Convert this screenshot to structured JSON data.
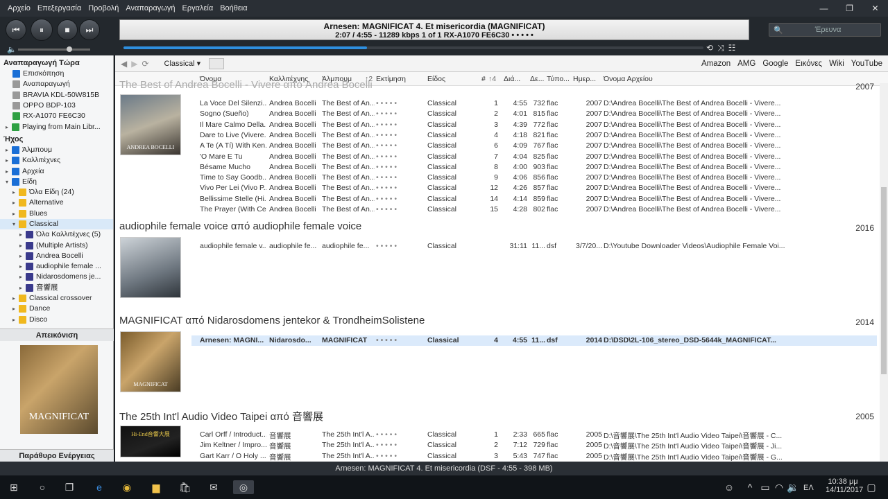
{
  "menu": [
    "Αρχείο",
    "Επεξεργασία",
    "Προβολή",
    "Αναπαραγωγή",
    "Εργαλεία",
    "Βοήθεια"
  ],
  "window_controls": {
    "min": "—",
    "max": "❐",
    "close": "✕"
  },
  "now_playing": {
    "line1": "Arnesen: MAGNIFICAT 4. Et misericordia (MAGNIFICAT)",
    "line2": "2:07 / 4:55 - 11289 kbps   1 of 1  RX-A1070 FE6C30  • • • • •",
    "progress": 0.42
  },
  "search_placeholder": "Έρευνα",
  "volume": 0.7,
  "left": {
    "playing_now_title": "Αναπαραγωγή Τώρα",
    "playing_items": [
      "Επισκόπηση",
      "Αναπαραγωγή",
      "BRAVIA KDL-50W815B",
      "OPPO BDP-103",
      "RX-A1070 FE6C30",
      "Playing from Main Libr..."
    ],
    "audio_title": "Ήχος",
    "audio_items": [
      "Άλμπουμ",
      "Καλλιτέχνες",
      "Αρχεία",
      "Είδη"
    ],
    "genres": [
      "Όλα Είδη (24)",
      "Alternative",
      "Blues",
      "Classical"
    ],
    "classical_children": [
      "Όλα Καλλιτέχνες (5)",
      "(Multiple Artists)",
      "Andrea Bocelli",
      "audiophile female ...",
      "Nidarosdomens je...",
      "音響展"
    ],
    "more_genres": [
      "Classical crossover",
      "Dance",
      "Disco"
    ],
    "preview_title": "Απεικόνιση",
    "action_title": "Παράθυρο Ενέργειας"
  },
  "toolbar": {
    "view_label": "Classical ▾",
    "links": [
      "Amazon",
      "AMG",
      "Google",
      "Εικόνες",
      "Wiki",
      "YouTube"
    ]
  },
  "columns": [
    "Όνομα",
    "Καλλιτέχνης",
    "Άλμπουμ",
    "Εκτίμηση",
    "Είδος",
    "#",
    "Διά...",
    "Δε...",
    "Τύπο...",
    "Ημερ...",
    "Όνομα Αρχείου"
  ],
  "column_sort": [
    "",
    "",
    "↑2",
    "",
    "",
    "↑4",
    "",
    "",
    "",
    "",
    ""
  ],
  "groups": [
    {
      "title": "The Best of Andrea Bocelli - Vivere από Andrea Bocelli",
      "year": "2007",
      "rows": [
        [
          "La Voce Del Silenzi...",
          "Andrea Bocelli",
          "The Best of An...",
          "• • • • •",
          "Classical",
          "1",
          "4:55",
          "732",
          "flac",
          "2007",
          "D:\\Andrea Bocelli\\The Best of Andrea Bocelli - Vivere..."
        ],
        [
          "Sogno (Sueño)",
          "Andrea Bocelli",
          "The Best of An...",
          "• • • • •",
          "Classical",
          "2",
          "4:01",
          "815",
          "flac",
          "2007",
          "D:\\Andrea Bocelli\\The Best of Andrea Bocelli - Vivere..."
        ],
        [
          "Il Mare Calmo Della...",
          "Andrea Bocelli",
          "The Best of An...",
          "• • • • •",
          "Classical",
          "3",
          "4:39",
          "772",
          "flac",
          "2007",
          "D:\\Andrea Bocelli\\The Best of Andrea Bocelli - Vivere..."
        ],
        [
          "Dare to Live (Vivere...",
          "Andrea Bocelli",
          "The Best of An...",
          "• • • • •",
          "Classical",
          "4",
          "4:18",
          "821",
          "flac",
          "2007",
          "D:\\Andrea Bocelli\\The Best of Andrea Bocelli - Vivere..."
        ],
        [
          "A Te (A Tí) With Ken...",
          "Andrea Bocelli",
          "The Best of An...",
          "• • • • •",
          "Classical",
          "6",
          "4:09",
          "767",
          "flac",
          "2007",
          "D:\\Andrea Bocelli\\The Best of Andrea Bocelli - Vivere..."
        ],
        [
          "'O Mare E Tu",
          "Andrea Bocelli",
          "The Best of An...",
          "• • • • •",
          "Classical",
          "7",
          "4:04",
          "825",
          "flac",
          "2007",
          "D:\\Andrea Bocelli\\The Best of Andrea Bocelli - Vivere..."
        ],
        [
          "Bésame Mucho",
          "Andrea Bocelli",
          "The Best of An...",
          "• • • • •",
          "Classical",
          "8",
          "4:00",
          "903",
          "flac",
          "2007",
          "D:\\Andrea Bocelli\\The Best of Andrea Bocelli - Vivere..."
        ],
        [
          "Time to Say Goodb...",
          "Andrea Bocelli",
          "The Best of An...",
          "• • • • •",
          "Classical",
          "9",
          "4:06",
          "856",
          "flac",
          "2007",
          "D:\\Andrea Bocelli\\The Best of Andrea Bocelli - Vivere..."
        ],
        [
          "Vivo Per Lei (Vivo P...",
          "Andrea Bocelli",
          "The Best of An...",
          "• • • • •",
          "Classical",
          "12",
          "4:26",
          "857",
          "flac",
          "2007",
          "D:\\Andrea Bocelli\\The Best of Andrea Bocelli - Vivere..."
        ],
        [
          "Bellissime Stelle (Hi...",
          "Andrea Bocelli",
          "The Best of An...",
          "• • • • •",
          "Classical",
          "14",
          "4:14",
          "859",
          "flac",
          "2007",
          "D:\\Andrea Bocelli\\The Best of Andrea Bocelli - Vivere..."
        ],
        [
          "The Prayer (With Ce...",
          "Andrea Bocelli",
          "The Best of An...",
          "• • • • •",
          "Classical",
          "15",
          "4:28",
          "802",
          "flac",
          "2007",
          "D:\\Andrea Bocelli\\The Best of Andrea Bocelli - Vivere..."
        ]
      ]
    },
    {
      "title": "audiophile female voice από audiophile female voice",
      "year": "2016",
      "rows": [
        [
          "audiophile female v...",
          "audiophile fe...",
          "audiophile fe...",
          "• • • • •",
          "Classical",
          "",
          "31:11",
          "11...",
          "dsf",
          "3/7/20...",
          "D:\\Youtube Downloader Videos\\Audiophile Female Voi..."
        ]
      ]
    },
    {
      "title": "MAGNIFICAT από Nidarosdomens jentekor & TrondheimSolistene",
      "year": "2014",
      "rows": [
        [
          "Arnesen: MAGNI...",
          "Nidarosdo...",
          "MAGNIFICAT",
          "• • • • •",
          "Classical",
          "4",
          "4:55",
          "11...",
          "dsf",
          "2014",
          "D:\\DSD\\2L-106_stereo_DSD-5644k_MAGNIFICAT..."
        ]
      ]
    },
    {
      "title": "The 25th Int'l Audio Video Taipei από 音響展",
      "year": "2005",
      "rows": [
        [
          "Carl Orff / Introduct...",
          "音響展",
          "The 25th Int'l A...",
          "• • • • •",
          "Classical",
          "1",
          "2:33",
          "665",
          "flac",
          "2005",
          "D:\\音響展\\The 25th Int'l Audio Video Taipei\\音響展 - C..."
        ],
        [
          "Jim Keltner / Impro...",
          "音響展",
          "The 25th Int'l A...",
          "• • • • •",
          "Classical",
          "2",
          "7:12",
          "729",
          "flac",
          "2005",
          "D:\\音響展\\The 25th Int'l Audio Video Taipei\\音響展 - Ji..."
        ],
        [
          "Gart Karr / O Holy ...",
          "音響展",
          "The 25th Int'l A...",
          "• • • • •",
          "Classical",
          "3",
          "5:43",
          "747",
          "flac",
          "2005",
          "D:\\音響展\\The 25th Int'l Audio Video Taipei\\音響展 - G..."
        ]
      ]
    }
  ],
  "album_art": {
    "bocelli": "ANDREA BOCELLI",
    "magnificat": "MAGNIFICAT",
    "taipei": "Hi-End音響大展"
  },
  "status_text": "Arnesen: MAGNIFICAT 4. Et misericordia (DSF - 4:55 - 398 MB)",
  "taskbar": {
    "lang": "ΕΛ",
    "time": "10:38 μμ",
    "date": "14/11/2017"
  },
  "colors": {
    "accent": "#2e8fdf",
    "highlight": "#dbeafb"
  }
}
